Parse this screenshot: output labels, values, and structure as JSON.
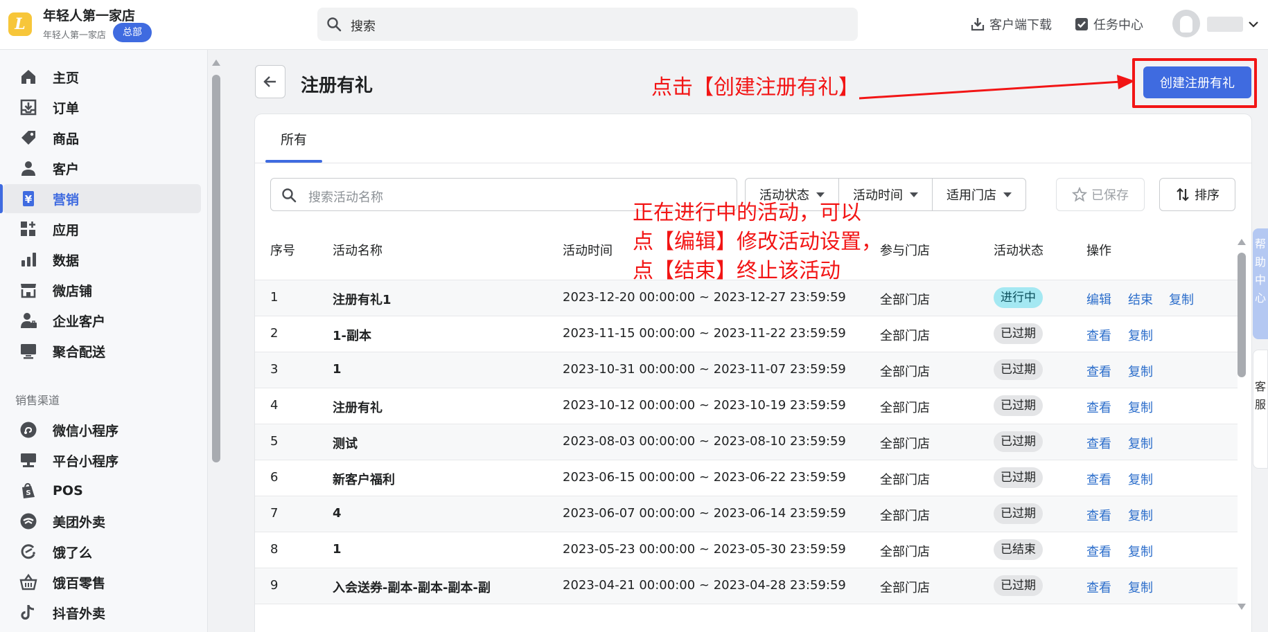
{
  "topbar": {
    "logo_letter": "L",
    "store_name": "年轻人第一家店",
    "store_sub": "年轻人第一家店",
    "hq_badge": "总部",
    "search_placeholder": "搜索",
    "download_label": "客户端下载",
    "task_center_label": "任务中心"
  },
  "sidebar": {
    "items": [
      {
        "label": "主页",
        "icon": "home-icon"
      },
      {
        "label": "订单",
        "icon": "order-icon"
      },
      {
        "label": "商品",
        "icon": "tag-icon"
      },
      {
        "label": "客户",
        "icon": "person-icon"
      },
      {
        "label": "营销",
        "icon": "yen-icon",
        "active": true
      },
      {
        "label": "应用",
        "icon": "apps-icon"
      },
      {
        "label": "数据",
        "icon": "bar-chart-icon"
      },
      {
        "label": "微店铺",
        "icon": "store-icon"
      },
      {
        "label": "企业客户",
        "icon": "enterprise-icon"
      },
      {
        "label": "聚合配送",
        "icon": "monitor-icon"
      }
    ],
    "section_title": "销售渠道",
    "channels": [
      {
        "label": "微信小程序",
        "icon": "mini-program-icon"
      },
      {
        "label": "平台小程序",
        "icon": "platform-icon"
      },
      {
        "label": "POS",
        "icon": "shopping-bag-icon"
      },
      {
        "label": "美团外卖",
        "icon": "meituan-icon"
      },
      {
        "label": "饿了么",
        "icon": "eleme-icon"
      },
      {
        "label": "饿百零售",
        "icon": "basket-icon"
      },
      {
        "label": "抖音外卖",
        "icon": "douyin-icon"
      }
    ]
  },
  "header": {
    "title": "注册有礼",
    "create_button": "创建注册有礼"
  },
  "annotations": {
    "create_hint": "点击【创建注册有礼】",
    "line1": "正在进行中的活动，可以",
    "line2": "点【编辑】修改活动设置，",
    "line3": "点【结束】终止该活动"
  },
  "tabs": [
    "所有"
  ],
  "filters": {
    "search_placeholder": "搜索活动名称",
    "status": "活动状态",
    "time": "活动时间",
    "store": "适用门店",
    "saved": "已保存",
    "sort": "排序"
  },
  "table": {
    "headers": [
      "序号",
      "活动名称",
      "活动时间",
      "参与门店",
      "活动状态",
      "操作"
    ],
    "rows": [
      {
        "no": "1",
        "name": "注册有礼1",
        "time": "2023-12-20 00:00:00 ~ 2023-12-27 23:59:59",
        "store": "全部门店",
        "status": "进行中",
        "a1": "编辑",
        "a2": "结束",
        "a3": "复制"
      },
      {
        "no": "2",
        "name": "1-副本",
        "time": "2023-11-15 00:00:00 ~ 2023-11-22 23:59:59",
        "store": "全部门店",
        "status": "已过期",
        "a1": "查看",
        "a2": "复制"
      },
      {
        "no": "3",
        "name": "1",
        "time": "2023-10-31 00:00:00 ~ 2023-11-07 23:59:59",
        "store": "全部门店",
        "status": "已过期",
        "a1": "查看",
        "a2": "复制"
      },
      {
        "no": "4",
        "name": "注册有礼",
        "time": "2023-10-12 00:00:00 ~ 2023-10-19 23:59:59",
        "store": "全部门店",
        "status": "已过期",
        "a1": "查看",
        "a2": "复制"
      },
      {
        "no": "5",
        "name": "测试",
        "time": "2023-08-03 00:00:00 ~ 2023-08-10 23:59:59",
        "store": "全部门店",
        "status": "已过期",
        "a1": "查看",
        "a2": "复制"
      },
      {
        "no": "6",
        "name": "新客户福利",
        "time": "2023-06-15 00:00:00 ~ 2023-06-22 23:59:59",
        "store": "全部门店",
        "status": "已过期",
        "a1": "查看",
        "a2": "复制"
      },
      {
        "no": "7",
        "name": "4",
        "time": "2023-06-07 00:00:00 ~ 2023-06-14 23:59:59",
        "store": "全部门店",
        "status": "已过期",
        "a1": "查看",
        "a2": "复制"
      },
      {
        "no": "8",
        "name": "1",
        "time": "2023-05-23 00:00:00 ~ 2023-05-30 23:59:59",
        "store": "全部门店",
        "status": "已结束",
        "a1": "查看",
        "a2": "复制"
      },
      {
        "no": "9",
        "name": "入会送券-副本-副本-副本-副",
        "time": "2023-04-21 00:00:00 ~ 2023-04-28 23:59:59",
        "store": "全部门店",
        "status": "已过期",
        "a1": "查看",
        "a2": "复制"
      }
    ]
  },
  "right_widgets": {
    "help": "帮助中心",
    "service": "客服"
  },
  "colors": {
    "accent": "#3f6be0",
    "annotation": "#f21515",
    "link": "#2c6ecb",
    "running_badge": "#a4e8f2"
  }
}
